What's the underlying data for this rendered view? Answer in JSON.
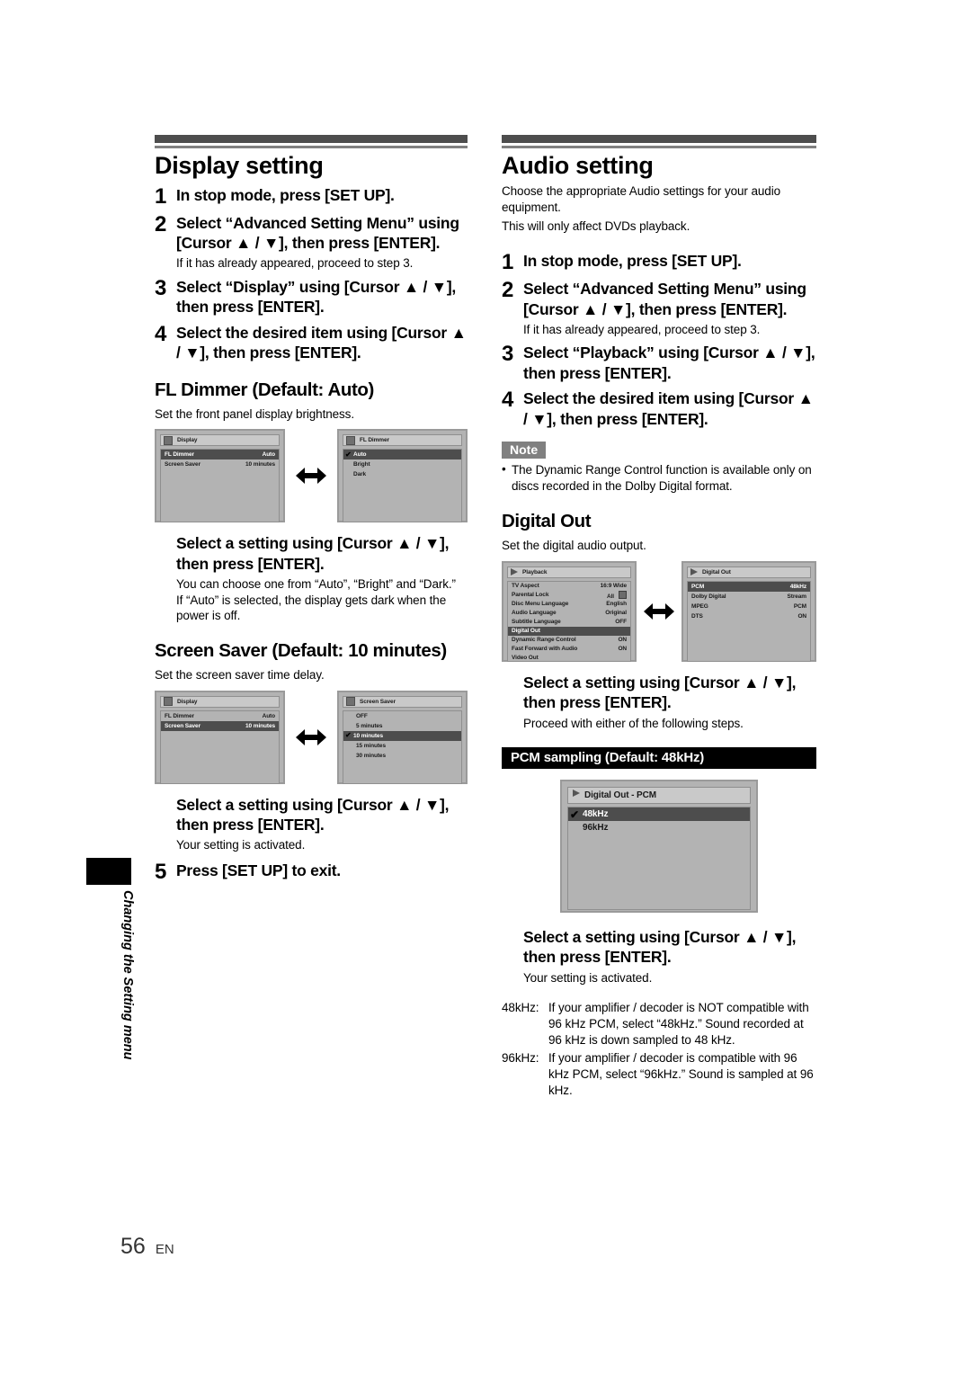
{
  "page": {
    "number": "56",
    "language": "EN",
    "side_tab_text": "Changing the Setting menu"
  },
  "left_column": {
    "section_title": "Display setting",
    "steps": [
      {
        "num": "1",
        "text": "In stop mode, press [SET UP]."
      },
      {
        "num": "2",
        "text": "Select “Advanced Setting Menu” using [Cursor ▲ / ▼], then press [ENTER].",
        "sub": "If it has already appeared, proceed to step 3."
      },
      {
        "num": "3",
        "text": "Select “Display” using [Cursor ▲ / ▼], then press [ENTER]."
      },
      {
        "num": "4",
        "text": "Select the desired item using [Cursor ▲ / ▼], then press [ENTER]."
      }
    ],
    "fl_dimmer": {
      "heading": "FL Dimmer (Default: Auto)",
      "description": "Set the front panel display brightness.",
      "screen_left": {
        "title": "Display",
        "rows": [
          {
            "label": "FL Dimmer",
            "value": "Auto",
            "selected": true
          },
          {
            "label": "Screen Saver",
            "value": "10 minutes",
            "selected": false
          }
        ]
      },
      "screen_right": {
        "title": "FL Dimmer",
        "options": [
          {
            "label": "Auto",
            "checked": true,
            "selected": true
          },
          {
            "label": "Bright",
            "checked": false,
            "selected": false
          },
          {
            "label": "Dark",
            "checked": false,
            "selected": false
          }
        ]
      },
      "instruction": "Select a setting using [Cursor ▲ / ▼], then press [ENTER].",
      "note_lines": [
        "You can choose one from “Auto”, “Bright” and “Dark.”",
        "If “Auto” is selected, the display gets dark when the power is off."
      ]
    },
    "screen_saver": {
      "heading": "Screen Saver (Default: 10 minutes)",
      "description": "Set the screen saver time delay.",
      "screen_left": {
        "title": "Display",
        "rows": [
          {
            "label": "FL Dimmer",
            "value": "Auto",
            "selected": false
          },
          {
            "label": "Screen Saver",
            "value": "10 minutes",
            "selected": true
          }
        ]
      },
      "screen_right": {
        "title": "Screen Saver",
        "options": [
          {
            "label": "OFF",
            "checked": false,
            "selected": false
          },
          {
            "label": "5 minutes",
            "checked": false,
            "selected": false
          },
          {
            "label": "10 minutes",
            "checked": true,
            "selected": true
          },
          {
            "label": "15 minutes",
            "checked": false,
            "selected": false
          },
          {
            "label": "30 minutes",
            "checked": false,
            "selected": false
          }
        ]
      },
      "instruction": "Select a setting using [Cursor ▲ / ▼], then press [ENTER].",
      "note_lines": [
        "Your setting is activated."
      ]
    },
    "final_step": {
      "num": "5",
      "text": "Press [SET UP] to exit."
    }
  },
  "right_column": {
    "section_title": "Audio setting",
    "intro_lines": [
      "Choose the appropriate Audio settings for your audio equipment.",
      "This will only affect DVDs playback."
    ],
    "steps": [
      {
        "num": "1",
        "text": "In stop mode, press [SET UP]."
      },
      {
        "num": "2",
        "text": "Select “Advanced Setting Menu” using [Cursor ▲ / ▼], then press [ENTER].",
        "sub": "If it has already appeared, proceed to step 3."
      },
      {
        "num": "3",
        "text": "Select “Playback” using [Cursor ▲ / ▼], then press [ENTER]."
      },
      {
        "num": "4",
        "text": "Select the desired item using [Cursor ▲ / ▼], then press [ENTER]."
      }
    ],
    "note": {
      "tag": "Note",
      "items": [
        "The Dynamic Range Control function is available only on discs recorded in the Dolby Digital format."
      ]
    },
    "digital_out": {
      "heading": "Digital Out",
      "description": "Set the digital audio output.",
      "screen_left": {
        "title": "Playback",
        "rows": [
          {
            "label": "TV Aspect",
            "value": "16:9 Wide",
            "selected": false
          },
          {
            "label": "Parental Lock",
            "value": "All",
            "icon": "lock-icon",
            "selected": false
          },
          {
            "label": "Disc Menu Language",
            "value": "English",
            "selected": false
          },
          {
            "label": "Audio Language",
            "value": "Original",
            "selected": false
          },
          {
            "label": "Subtitle Language",
            "value": "OFF",
            "selected": false
          },
          {
            "label": "Digital Out",
            "value": "",
            "selected": true
          },
          {
            "label": "Dynamic Range Control",
            "value": "ON",
            "selected": false
          },
          {
            "label": "Fast Forward with Audio",
            "value": "ON",
            "selected": false
          },
          {
            "label": "Video Out",
            "value": "",
            "selected": false
          }
        ]
      },
      "screen_right": {
        "title": "Digital Out",
        "rows": [
          {
            "label": "PCM",
            "value": "48kHz",
            "selected": true
          },
          {
            "label": "Dolby Digital",
            "value": "Stream",
            "selected": false
          },
          {
            "label": "MPEG",
            "value": "PCM",
            "selected": false
          },
          {
            "label": "DTS",
            "value": "ON",
            "selected": false
          }
        ]
      },
      "instruction": "Select a setting using [Cursor ▲ / ▼], then press [ENTER].",
      "note_lines": [
        "Proceed with either of the following steps."
      ]
    },
    "pcm_sampling": {
      "banner": "PCM sampling (Default: 48kHz)",
      "screen": {
        "title": "Digital Out - PCM",
        "options": [
          {
            "label": "48kHz",
            "checked": true,
            "selected": true
          },
          {
            "label": "96kHz",
            "checked": false,
            "selected": false
          }
        ]
      },
      "instruction": "Select a setting using [Cursor ▲ / ▼], then press [ENTER].",
      "note_lines": [
        "Your setting is activated."
      ],
      "definitions": [
        {
          "key": "48kHz:",
          "desc": "If your amplifier / decoder is NOT compatible with 96 kHz PCM, select “48kHz.” Sound recorded at 96 kHz is down sampled to 48 kHz."
        },
        {
          "key": "96kHz:",
          "desc": "If your amplifier / decoder is compatible with 96 kHz PCM, select “96kHz.” Sound is sampled at 96 kHz."
        }
      ]
    }
  }
}
